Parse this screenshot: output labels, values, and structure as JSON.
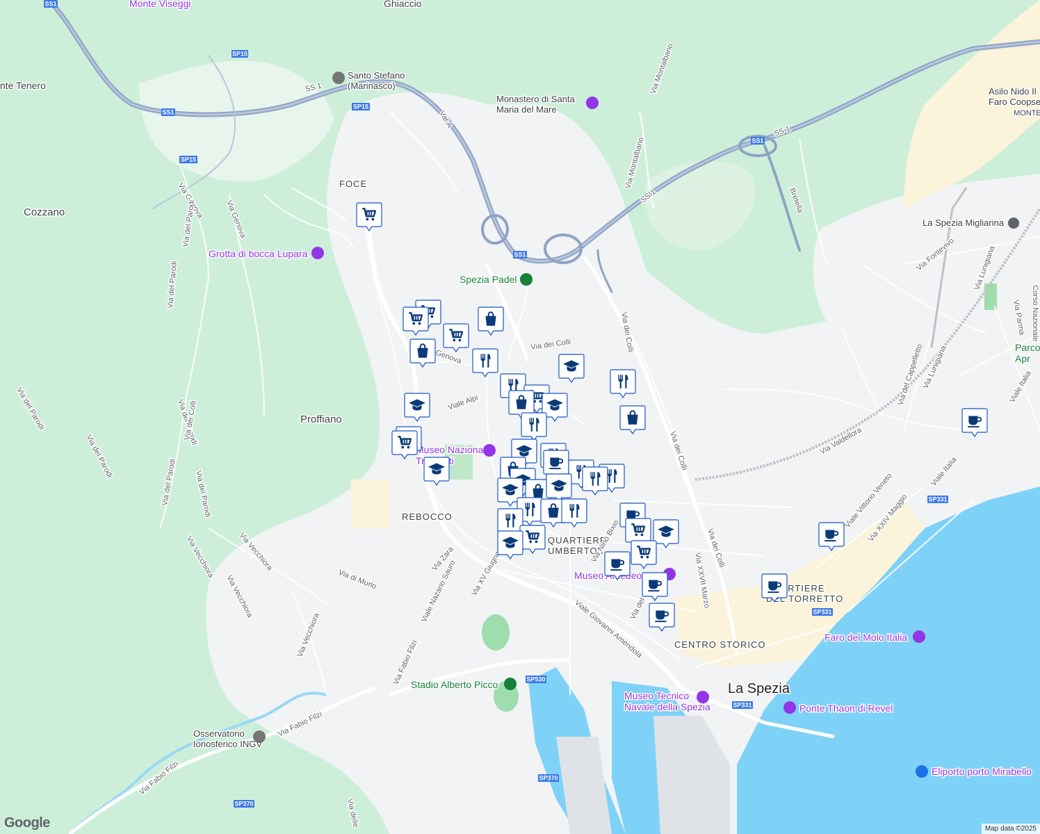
{
  "map": {
    "google_logo": "Google",
    "attribution": "Map data ©2025",
    "colors": {
      "forest": "#cdefd9",
      "urban": "#f1f3f4",
      "water": "#7fd2f7",
      "highway": "#8fa3c4",
      "sand": "#fbf3da",
      "marker_icon": "#0b3a78"
    },
    "places": {
      "ghiaccio": "Ghiaccio",
      "monte_viseggi": "Monte Viseggi",
      "santo_stefano": "Santo Stefano\n(Marinasco)",
      "monte_tenero": "nte Tenero",
      "monastero": "Monastero di Santa\nMaria del Mare",
      "foce": "FOCE",
      "cozzano": "Cozzano",
      "grotta": "Grotta di bocca Lupara",
      "spezia_padel": "Spezia Padel",
      "proffiano": "Proffiano",
      "museo_trasporti": "Museo Nazionale\nTrasporti",
      "rebocco": "REBOCCO",
      "quartiere_umberto": "QUARTIERE\nUMBERTO I",
      "museo_centro": "Museo Amedeo",
      "quartiere_torretto": "QUARTIERE\nDEL TORRETTO",
      "faro_molo": "Faro del Molo Italia",
      "centro_storico": "CENTRO STORICO",
      "la_spezia": "La Spezia",
      "museo_tecnico": "Museo Tecnico\nNavale della Spezia",
      "ponte_thaon": "Ponte Thaon di Revel",
      "stadio": "Stadio Alberto Picco",
      "osservatorio": "Osservatorio\nIonosferico INGV",
      "eliporto": "Eliporto porto Mirabello",
      "migliarina": "La Spezia Migliarina",
      "asilo": "Asilo Nido Il\nFaro Coopselios",
      "monte_right": "MONTE",
      "parco": "Parco\nApr"
    },
    "roads": {
      "ss1_a": "SS 1",
      "ss1_b": "SS 1",
      "ss1_c": "SS 1",
      "var_a": "Var.A",
      "via_montalbano_a": "Via Montalbano",
      "via_montalbano_b": "Via Montalbano",
      "bretella": "Bretella",
      "via_genova_a": "Via Genova",
      "via_genova_b": "Via Genova",
      "via_genova_c": "Genova",
      "via_del_parodi_a": "Via del Parodi",
      "via_del_parodi_b": "Via del Parodi",
      "via_del_parodi_c": "Via del Parodi",
      "via_del_parodi_d": "Via del Parodi",
      "via_del_parodi_e": "Via del Parodi",
      "via_del_parodi_f": "Via del Parodi",
      "via_del_parodi_g": "Via del Parodi",
      "via_dei_colli_a": "Via dei Colli",
      "via_dei_colli_b": "Via dei Colli",
      "via_dei_colli_c": "Via dei Colli",
      "via_dei_colli_d": "Via dei Colli",
      "viale_alpi": "Viale Alpi",
      "via_vecchiora_a": "Via Vecchiora",
      "via_vecchiora_b": "Via Vecchiora",
      "via_vecchiora_c": "Via Vecchiora",
      "via_vecchiora_d": "Via Vecchiora",
      "via_di_murlo": "Via di Murlo",
      "via_zara": "Via Zara",
      "viale_nazario_sauro": "Viale Nazario Sauro",
      "via_xv_giugno": "Via XV Giugno",
      "via_fabio_filzi_a": "Via Fabio Filzi",
      "via_fabio_filzi_b": "Via Fabio Filzi",
      "via_fabio_filzi_c": "Via Fabio Filzi",
      "viale_amendola": "Viale Giovanni Amendola",
      "via_nino_bixio": "Via Nino Bixio",
      "via_del_mille": "Via del Mille",
      "via_xxvii_marzo": "Via XXVII Marzo",
      "via_fontevivo": "Via Fontevivo",
      "via_lunigiana_a": "Via Lunigiana",
      "via_lunigiana_b": "Via Lunigiana",
      "via_parma": "Via Parma",
      "corso_nazionale": "Corso Nazionale",
      "via_del_cappelletto": "Via del Cappelletto",
      "via_valdellora": "Via Valdellora",
      "viale_vittorio_veneto": "Viale Vittorio Veneto",
      "via_xxiv_maggio": "Via XXIV Maggio",
      "viale_italia_a": "Viale Italia",
      "viale_italia_b": "Viale Italia",
      "via_delle": "Via delle",
      "via_dei_colli_e": "Via dei Colli"
    },
    "shields": {
      "sp15_a": "SP15",
      "sp15_b": "SP15",
      "sp15_c": "SP15",
      "ss1_a": "SS1",
      "ss1_b": "SS1",
      "ss1_c": "SS1",
      "ss1_d": "SS1",
      "sp530": "SP530",
      "sp370_a": "SP370",
      "sp370_b": "SP370",
      "sp331_a": "SP331",
      "sp331_b": "SP331",
      "sp331_c": "SP331"
    },
    "marker_types": {
      "cart": "shopping-cart-icon",
      "bag": "shopping-bag-icon",
      "fork": "restaurant-icon",
      "cap": "school-icon",
      "cup": "cafe-icon"
    }
  }
}
